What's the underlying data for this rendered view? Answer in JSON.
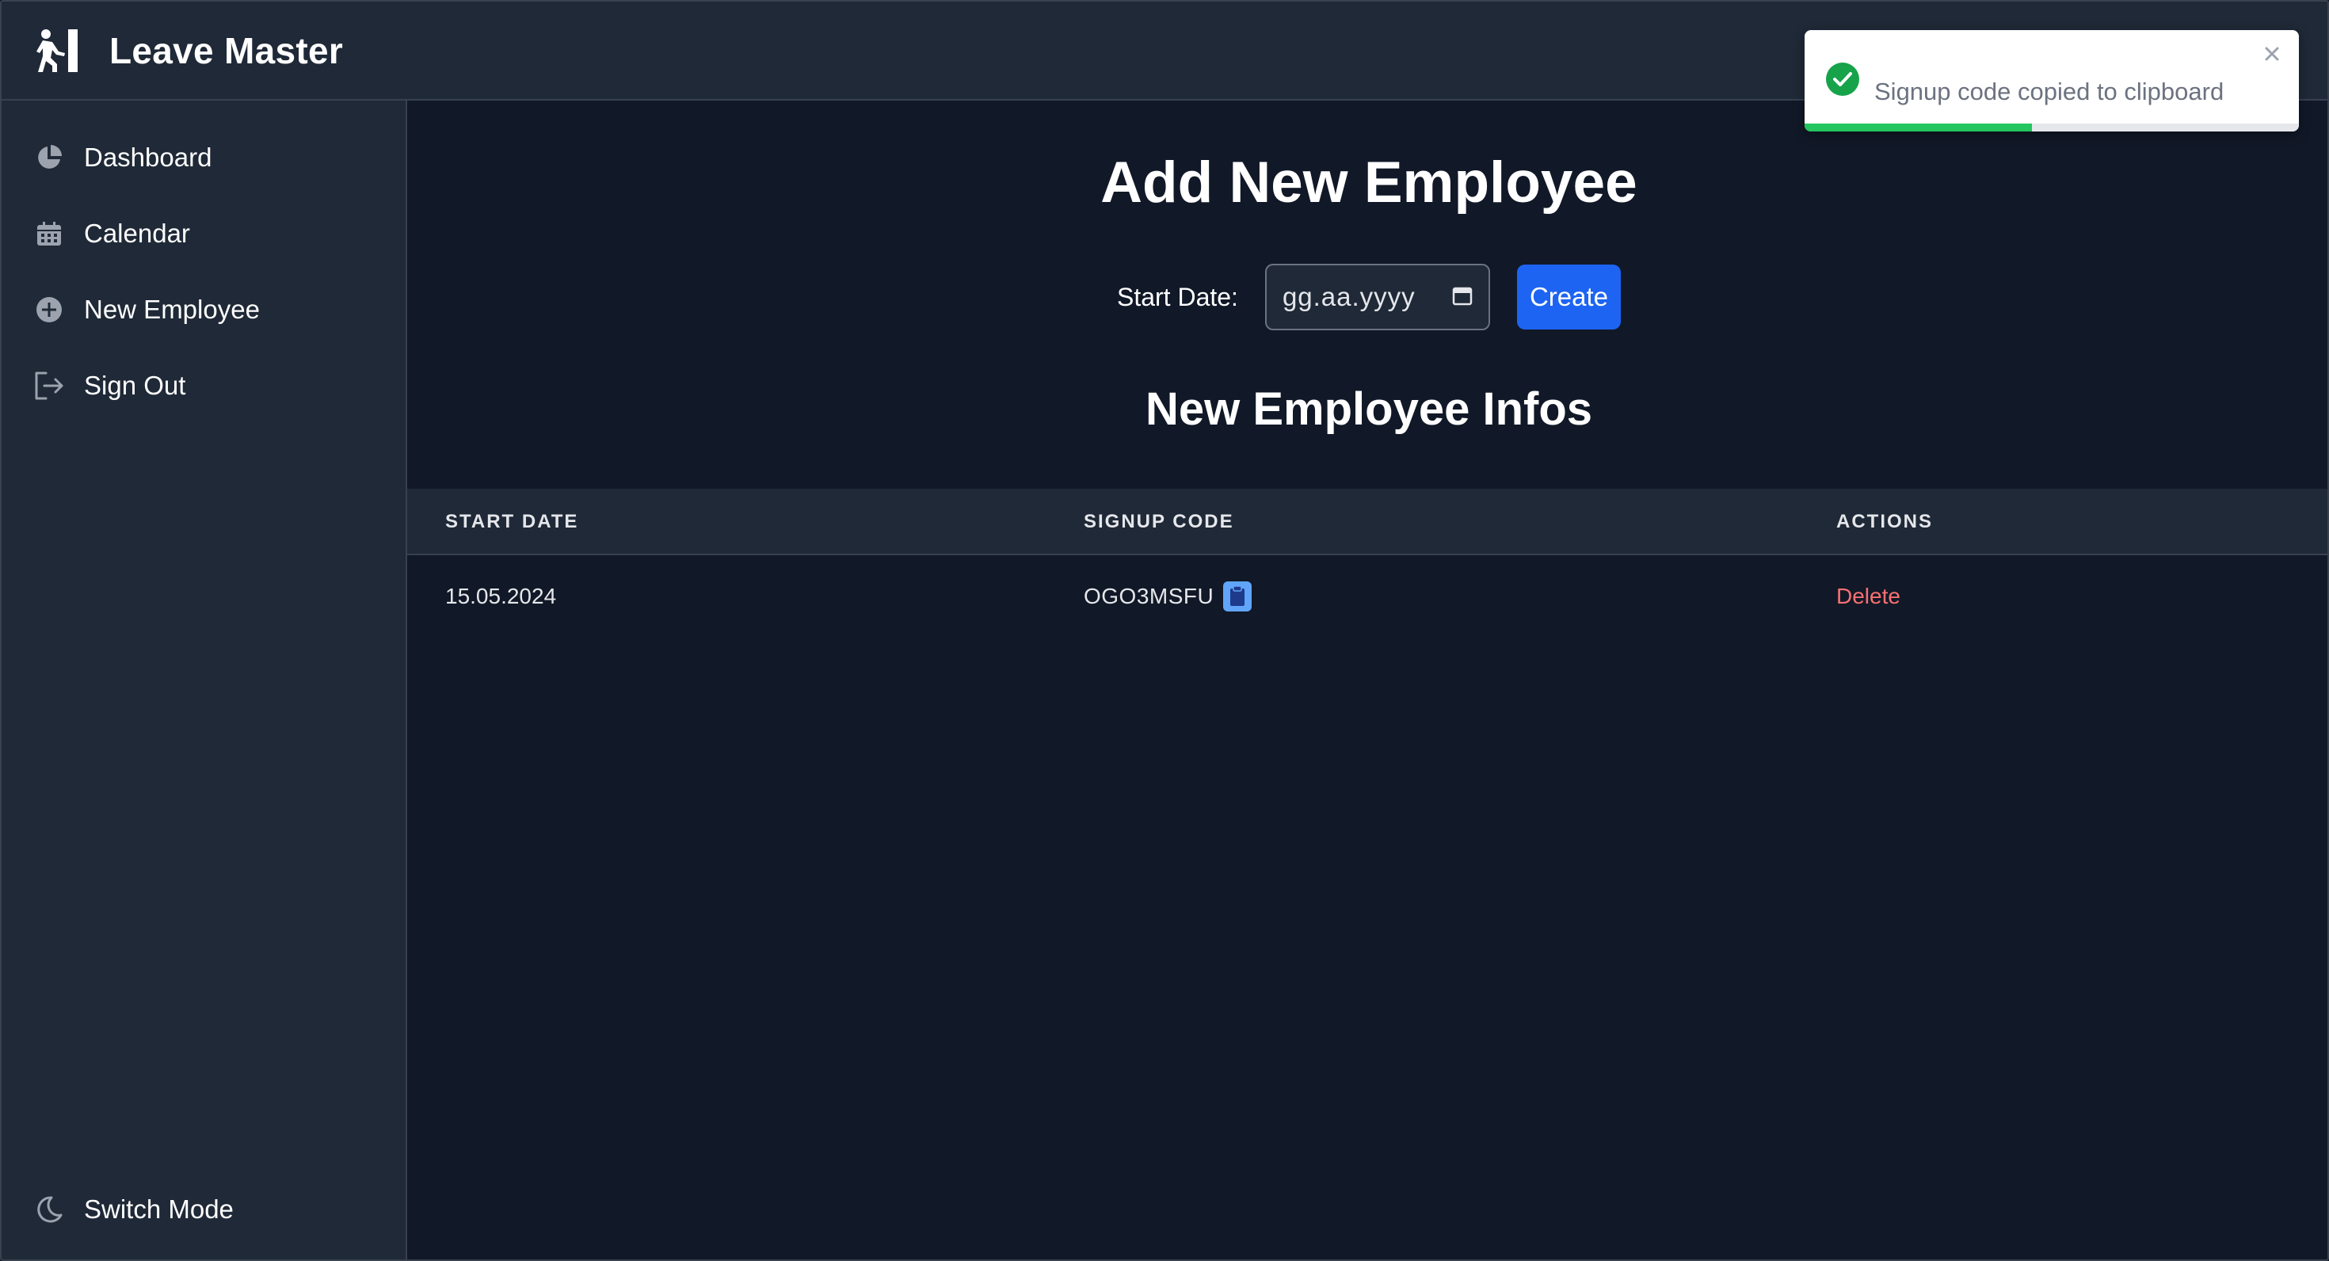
{
  "app": {
    "title": "Leave Master"
  },
  "sidebar": {
    "items": [
      {
        "label": "Dashboard",
        "icon": "pie-chart-icon"
      },
      {
        "label": "Calendar",
        "icon": "calendar-icon"
      },
      {
        "label": "New Employee",
        "icon": "plus-circle-icon"
      },
      {
        "label": "Sign Out",
        "icon": "sign-out-icon"
      }
    ],
    "footer": {
      "label": "Switch Mode",
      "icon": "moon-icon"
    }
  },
  "main": {
    "title": "Add New Employee",
    "form": {
      "start_date_label": "Start Date:",
      "date_placeholder": "gg.aa.yyyy",
      "create_label": "Create"
    },
    "section_title": "New Employee Infos",
    "table": {
      "headers": [
        "START DATE",
        "SIGNUP CODE",
        "ACTIONS"
      ],
      "rows": [
        {
          "start_date": "15.05.2024",
          "signup_code": "OGO3MSFU",
          "action": "Delete"
        }
      ]
    }
  },
  "toast": {
    "message": "Signup code copied to clipboard",
    "progress": 0.46
  },
  "colors": {
    "background": "#111827",
    "panel": "#1f2937",
    "accent": "#1d64f2",
    "danger": "#f87171",
    "success": "#22c55e"
  }
}
